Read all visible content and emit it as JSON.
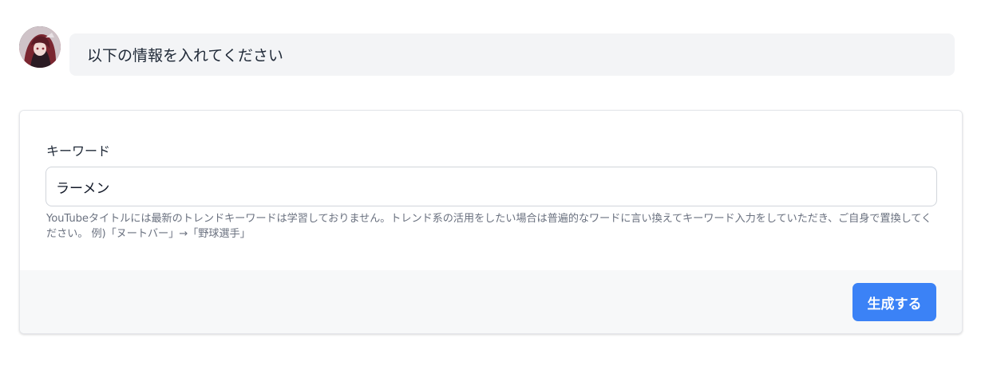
{
  "chat": {
    "avatar_icon": "user-avatar-image",
    "message": "以下の情報を入れてください"
  },
  "form": {
    "keyword_label": "キーワード",
    "keyword_value": "ラーメン",
    "help_text": "YouTubeタイトルには最新のトレンドキーワードは学習しておりません。トレンド系の活用をしたい場合は普遍的なワードに言い換えてキーワード入力をしていただき、ご自身で置換してください。 例)「ヌートバー」→「野球選手」",
    "submit_label": "生成する"
  },
  "colors": {
    "accent": "#3b82f6",
    "bubble_bg": "#f3f4f6",
    "footer_bg": "#f7f8f9"
  }
}
